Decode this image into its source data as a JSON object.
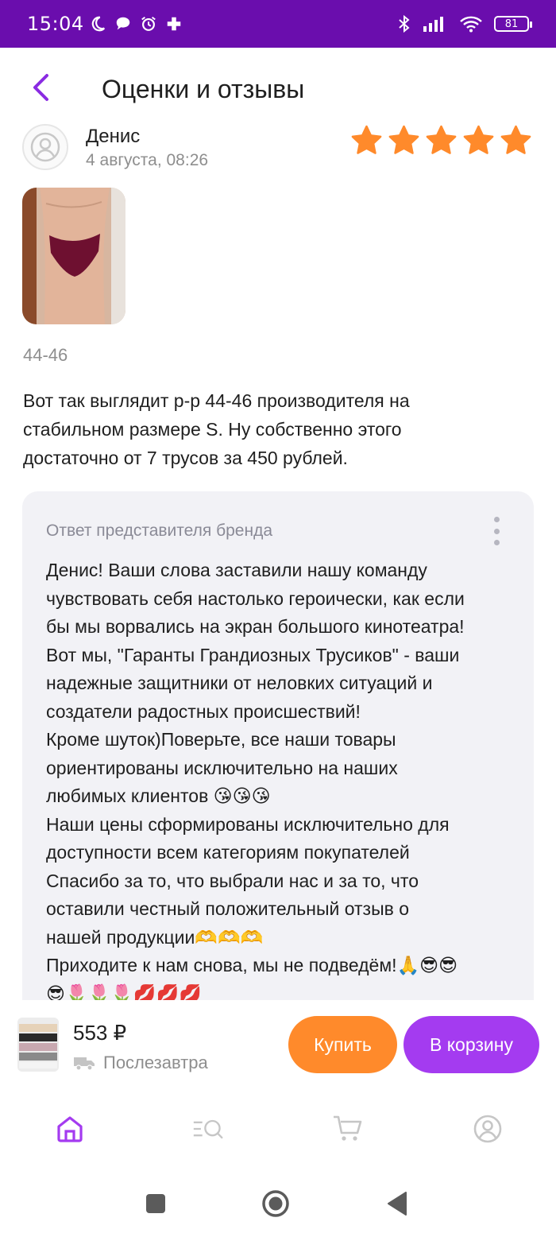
{
  "status_bar": {
    "time": "15:04",
    "battery": "81"
  },
  "header": {
    "title": "Оценки и отзывы"
  },
  "review": {
    "author": "Денис",
    "date": "4 августа, 08:26",
    "rating": 5,
    "rating_max": 5,
    "size": "44-46",
    "text": "Вот так выглядит р-р 44-46 производителя на\nстабильном размере S. Ну собственно этого\nдостаточно от 7 трусов за 450 рублей."
  },
  "brand_answer": {
    "title": "Ответ представителя бренда",
    "text": "Денис! Ваши слова заставили нашу команду\nчувствовать себя настолько героически, как если\nбы мы ворвались на экран большого кинотеатра!\nВот мы, \"Гаранты Грандиозных Трусиков\" - ваши\nнадежные защитники от неловких ситуаций и\nсоздатели радостных происшествий!\nКроме шуток)Поверьте, все наши товары\nориентированы исключительно на наших\nлюбимых клиентов 😘😘😘\nНаши цены сформированы исключительно для\nдоступности всем категориям покупателей\nСпасибо за то, что выбрали нас и за то, что\nоставили честный положительный отзыв о\nнашей продукции🫶🫶🫶\nПриходите к нам снова, мы не подведём!🙏😎😎\n😎🌷🌷🌷💋💋💋"
  },
  "buy_bar": {
    "price": "553 ₽",
    "delivery": "Послезавтра",
    "buy_label": "Купить",
    "cart_label": "В корзину"
  },
  "colors": {
    "status_bar": "#6a0dad",
    "accent_purple": "#a43bf0",
    "accent_orange": "#ff8a2b",
    "star": "#ff8a2b"
  },
  "icons": {
    "back": "chevron-left-icon",
    "nav": [
      "home-icon",
      "catalog-search-icon",
      "cart-icon",
      "profile-icon"
    ],
    "system": [
      "recents-square-icon",
      "home-circle-icon",
      "back-triangle-icon"
    ]
  }
}
